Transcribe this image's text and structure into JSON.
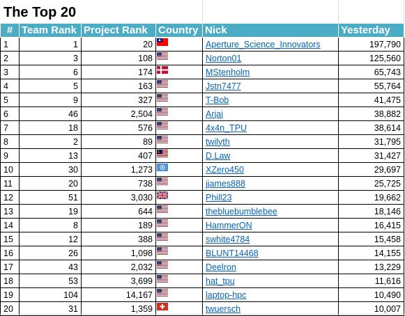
{
  "title": "The Top 20",
  "headers": {
    "hash": "#",
    "team_rank": "Team Rank",
    "project_rank": "Project Rank",
    "country": "Country",
    "nick": "Nick",
    "yesterday": "Yesterday"
  },
  "flag_colors": {
    "us": "#b22234",
    "tw": "#fe0000",
    "dk": "#c60c30",
    "gb": "#012169",
    "my": "#010066",
    "un": "#4b92db",
    "ch": "#d52b1e"
  },
  "rows": [
    {
      "n": "1",
      "team": "1",
      "project": "20",
      "flag": "tw-flag-icon",
      "nick": "Aperture_Science_Innovators",
      "yesterday": "197,790"
    },
    {
      "n": "2",
      "team": "3",
      "project": "108",
      "flag": "us-flag-icon",
      "nick": "Norton01",
      "yesterday": "125,560"
    },
    {
      "n": "3",
      "team": "6",
      "project": "174",
      "flag": "dk-flag-icon",
      "nick": "MStenholm",
      "yesterday": "65,743"
    },
    {
      "n": "4",
      "team": "5",
      "project": "163",
      "flag": "us-flag-icon",
      "nick": "Jstn7477",
      "yesterday": "55,764"
    },
    {
      "n": "5",
      "team": "9",
      "project": "327",
      "flag": "us-flag-icon",
      "nick": "T-Bob",
      "yesterday": "41,475"
    },
    {
      "n": "6",
      "team": "46",
      "project": "2,504",
      "flag": "us-flag-icon",
      "nick": "Arjai",
      "yesterday": "38,882"
    },
    {
      "n": "7",
      "team": "18",
      "project": "576",
      "flag": "us-flag-icon",
      "nick": "4x4n_TPU",
      "yesterday": "38,614"
    },
    {
      "n": "8",
      "team": "2",
      "project": "89",
      "flag": "us-flag-icon",
      "nick": "twilyth",
      "yesterday": "31,795"
    },
    {
      "n": "9",
      "team": "13",
      "project": "407",
      "flag": "my-flag-icon",
      "nick": "D.Law",
      "yesterday": "31,427"
    },
    {
      "n": "10",
      "team": "30",
      "project": "1,273",
      "flag": "un-flag-icon",
      "nick": "XZero450",
      "yesterday": "29,697"
    },
    {
      "n": "11",
      "team": "20",
      "project": "738",
      "flag": "us-flag-icon",
      "nick": "jjames888",
      "yesterday": "25,725"
    },
    {
      "n": "12",
      "team": "51",
      "project": "3,030",
      "flag": "gb-flag-icon",
      "nick": "Phill23",
      "yesterday": "19,662"
    },
    {
      "n": "13",
      "team": "19",
      "project": "644",
      "flag": "us-flag-icon",
      "nick": "thebluebumblebee",
      "yesterday": "18,146"
    },
    {
      "n": "14",
      "team": "8",
      "project": "189",
      "flag": "us-flag-icon",
      "nick": "HammerON",
      "yesterday": "16,415"
    },
    {
      "n": "15",
      "team": "12",
      "project": "388",
      "flag": "us-flag-icon",
      "nick": "swhite4784",
      "yesterday": "15,458"
    },
    {
      "n": "16",
      "team": "26",
      "project": "1,098",
      "flag": "us-flag-icon",
      "nick": "BLUNT14468",
      "yesterday": "14,155"
    },
    {
      "n": "17",
      "team": "43",
      "project": "2,032",
      "flag": "us-flag-icon",
      "nick": "Deelron",
      "yesterday": "13,229"
    },
    {
      "n": "18",
      "team": "53",
      "project": "3,699",
      "flag": "us-flag-icon",
      "nick": "hat_tpu",
      "yesterday": "11,616"
    },
    {
      "n": "19",
      "team": "104",
      "project": "14,167",
      "flag": "us-flag-icon",
      "nick": "laptop-hpc",
      "yesterday": "10,490"
    },
    {
      "n": "20",
      "team": "31",
      "project": "1,359",
      "flag": "ch-flag-icon",
      "nick": "twuersch",
      "yesterday": "10,007"
    }
  ]
}
